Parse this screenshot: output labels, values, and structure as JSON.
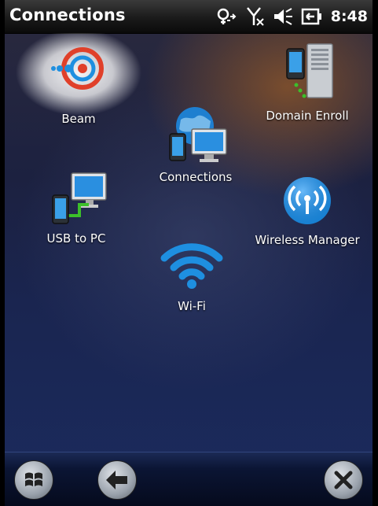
{
  "title": "Connections",
  "status": {
    "time": "8:48",
    "icons": [
      "sync-icon",
      "no-signal-icon",
      "speaker-icon",
      "battery-charging-icon"
    ]
  },
  "tiles": [
    {
      "id": "beam",
      "label": "Beam",
      "icon": "beam-icon"
    },
    {
      "id": "domain-enroll",
      "label": "Domain Enroll",
      "icon": "domain-enroll-icon"
    },
    {
      "id": "connections",
      "label": "Connections",
      "icon": "connections-icon"
    },
    {
      "id": "usb-to-pc",
      "label": "USB to PC",
      "icon": "usb-to-pc-icon"
    },
    {
      "id": "wireless-manager",
      "label": "Wireless Manager",
      "icon": "wireless-manager-icon"
    },
    {
      "id": "wifi",
      "label": "Wi-Fi",
      "icon": "wifi-icon"
    }
  ],
  "taskbar": {
    "buttons": [
      "start-icon",
      "back-icon",
      "close-icon"
    ]
  },
  "colors": {
    "accent_blue": "#1e8fe0",
    "beam_red": "#e0402a",
    "usb_green": "#3cbf2a"
  }
}
